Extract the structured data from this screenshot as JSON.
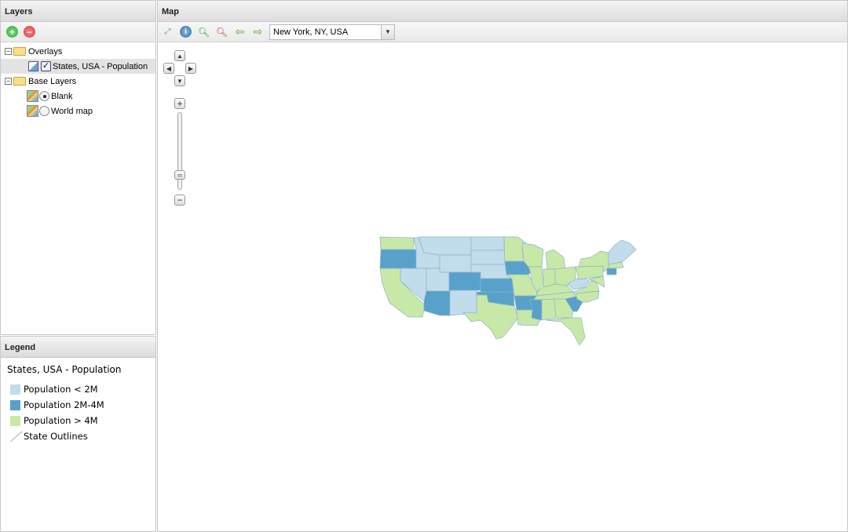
{
  "layers_panel": {
    "title": "Layers",
    "add_icon": "add-icon",
    "remove_icon": "remove-icon",
    "tree": {
      "overlays": {
        "label": "Overlays",
        "children": [
          {
            "label": "States, USA - Population",
            "checked": true
          }
        ]
      },
      "base_layers": {
        "label": "Base Layers",
        "children": [
          {
            "label": "Blank",
            "selected": true
          },
          {
            "label": "World map",
            "selected": false
          }
        ]
      }
    }
  },
  "legend_panel": {
    "title": "Legend",
    "layer_title": "States, USA - Population",
    "items": [
      {
        "label": "Population < 2M",
        "color": "#c1dceb"
      },
      {
        "label": "Population 2M-4M",
        "color": "#58a1ca"
      },
      {
        "label": "Population > 4M",
        "color": "#c8e8a8"
      },
      {
        "label": "State Outlines",
        "color": "#8fb3cc"
      }
    ]
  },
  "map_panel": {
    "title": "Map",
    "toolbar": {
      "tools": [
        "zoom-extent-icon",
        "info-icon",
        "zoom-in-icon",
        "zoom-out-icon",
        "back-arrow-icon",
        "forward-arrow-icon"
      ],
      "location_value": "New York, NY, USA"
    },
    "zoom_slider_level": 0.2
  }
}
